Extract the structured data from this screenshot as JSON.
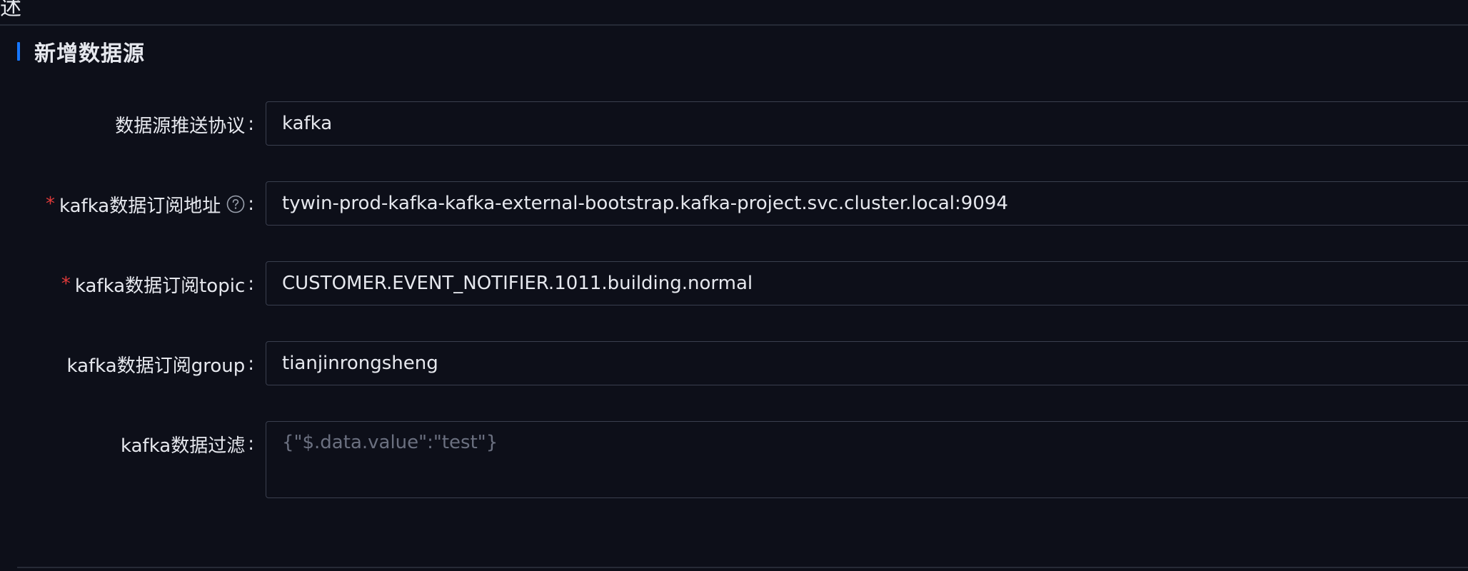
{
  "header": {
    "fragment": "述"
  },
  "section": {
    "title": "新增数据源"
  },
  "form": {
    "protocol": {
      "label": "数据源推送协议",
      "colon": ":",
      "value": "kafka"
    },
    "address": {
      "required_mark": "*",
      "label": "kafka数据订阅地址",
      "colon": ":",
      "value": "tywin-prod-kafka-kafka-external-bootstrap.kafka-project.svc.cluster.local:9094",
      "help_icon": "question-circle-icon"
    },
    "topic": {
      "required_mark": "*",
      "label": "kafka数据订阅topic",
      "colon": ":",
      "value": "CUSTOMER.EVENT_NOTIFIER.1011.building.normal"
    },
    "group": {
      "label": "kafka数据订阅group",
      "colon": ":",
      "value": "tianjinrongsheng"
    },
    "filter": {
      "label": "kafka数据过滤",
      "colon": ":",
      "placeholder": "{\"$.data.value\":\"test\"}"
    }
  },
  "colors": {
    "background": "#0d0f19",
    "accent": "#1677ff",
    "required": "#e03a3a",
    "border": "#3a3f4e",
    "text": "#e6e8ee",
    "placeholder": "#6b7080"
  }
}
